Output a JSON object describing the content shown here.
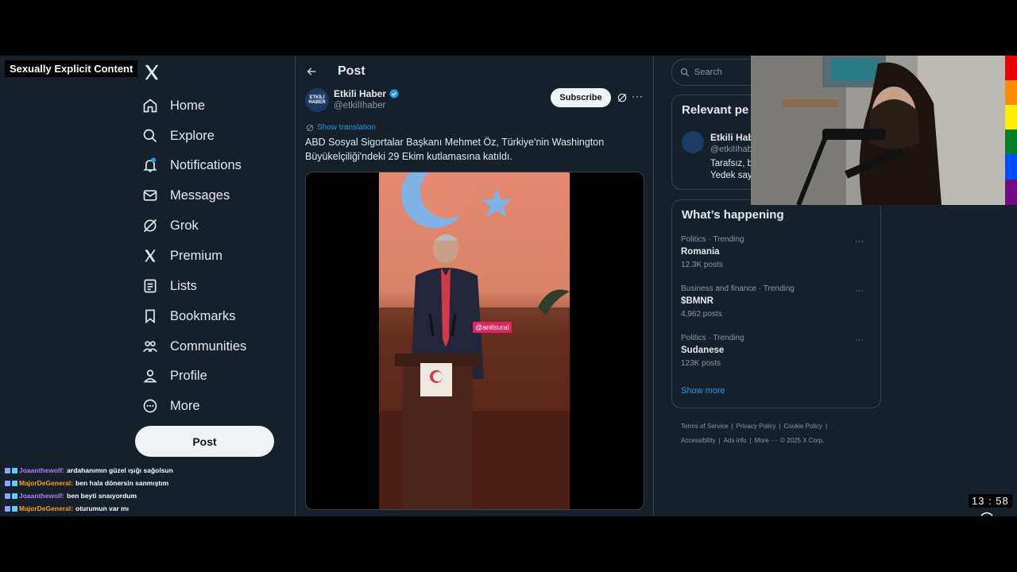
{
  "overlay": {
    "nsfw_label": "Sexually Explicit Content",
    "timer": "13 : 58"
  },
  "nav": {
    "items": [
      {
        "label": "Home",
        "icon": "home-icon"
      },
      {
        "label": "Explore",
        "icon": "search-icon"
      },
      {
        "label": "Notifications",
        "icon": "bell-icon"
      },
      {
        "label": "Messages",
        "icon": "mail-icon"
      },
      {
        "label": "Grok",
        "icon": "grok-icon"
      },
      {
        "label": "Premium",
        "icon": "x-icon"
      },
      {
        "label": "Lists",
        "icon": "list-icon"
      },
      {
        "label": "Bookmarks",
        "icon": "bookmark-icon"
      },
      {
        "label": "Communities",
        "icon": "people-icon"
      },
      {
        "label": "Profile",
        "icon": "user-icon"
      },
      {
        "label": "More",
        "icon": "more-circle-icon"
      }
    ],
    "post_label": "Post"
  },
  "chat": [
    {
      "name": "Joaanthewolf",
      "color": "#b77bff",
      "msg": "ardahanımın güzel ışığı sağolsun"
    },
    {
      "name": "MajorDeGeneral",
      "color": "#ff9f1a",
      "msg": "ben hala dönersin sanmıştım"
    },
    {
      "name": "Joaanthewolf",
      "color": "#b77bff",
      "msg": "ben beyti snaıyordum"
    },
    {
      "name": "MajorDeGeneral",
      "color": "#ff9f1a",
      "msg": "oturumun var mı"
    }
  ],
  "post": {
    "header_title": "Post",
    "author_name": "Etkili Haber",
    "author_handle": "@etkiIIhaber",
    "avatar_text": "ETKİLİ HABER",
    "subscribe_label": "Subscribe",
    "show_translation": "Show translation",
    "text": "ABD Sosyal Sigortalar Başkanı Mehmet Öz, Türkiye'nin Washington Büyükelçiliği'ndeki 29 Ekim kutlamasına katıldı.",
    "media_tag": "@anilsural"
  },
  "right": {
    "search_placeholder": "Search",
    "relevant_title": "Relevant pe",
    "relevant_name": "Etkili Hab",
    "relevant_handle": "@etkiIIhab",
    "relevant_bio_1": "Tarafsız, b",
    "relevant_bio_2": "Yedek say",
    "happening_title": "What’s happening",
    "trends": [
      {
        "category": "Politics · Trending",
        "name": "Romania",
        "count": "12.3K posts"
      },
      {
        "category": "Business and finance · Trending",
        "name": "$BMNR",
        "count": "4,962 posts"
      },
      {
        "category": "Politics · Trending",
        "name": "Sudanese",
        "count": "123K posts"
      }
    ],
    "show_more": "Show more",
    "footer": [
      "Terms of Service",
      "|",
      "Privacy Policy",
      "|",
      "Cookie Policy",
      "|",
      "Accessibility",
      "|",
      "Ads info",
      "|",
      "More ···",
      "© 2025 X Corp."
    ]
  },
  "colors": {
    "background": "#15202b",
    "accent": "#1d9bf0",
    "border": "#38444d"
  }
}
